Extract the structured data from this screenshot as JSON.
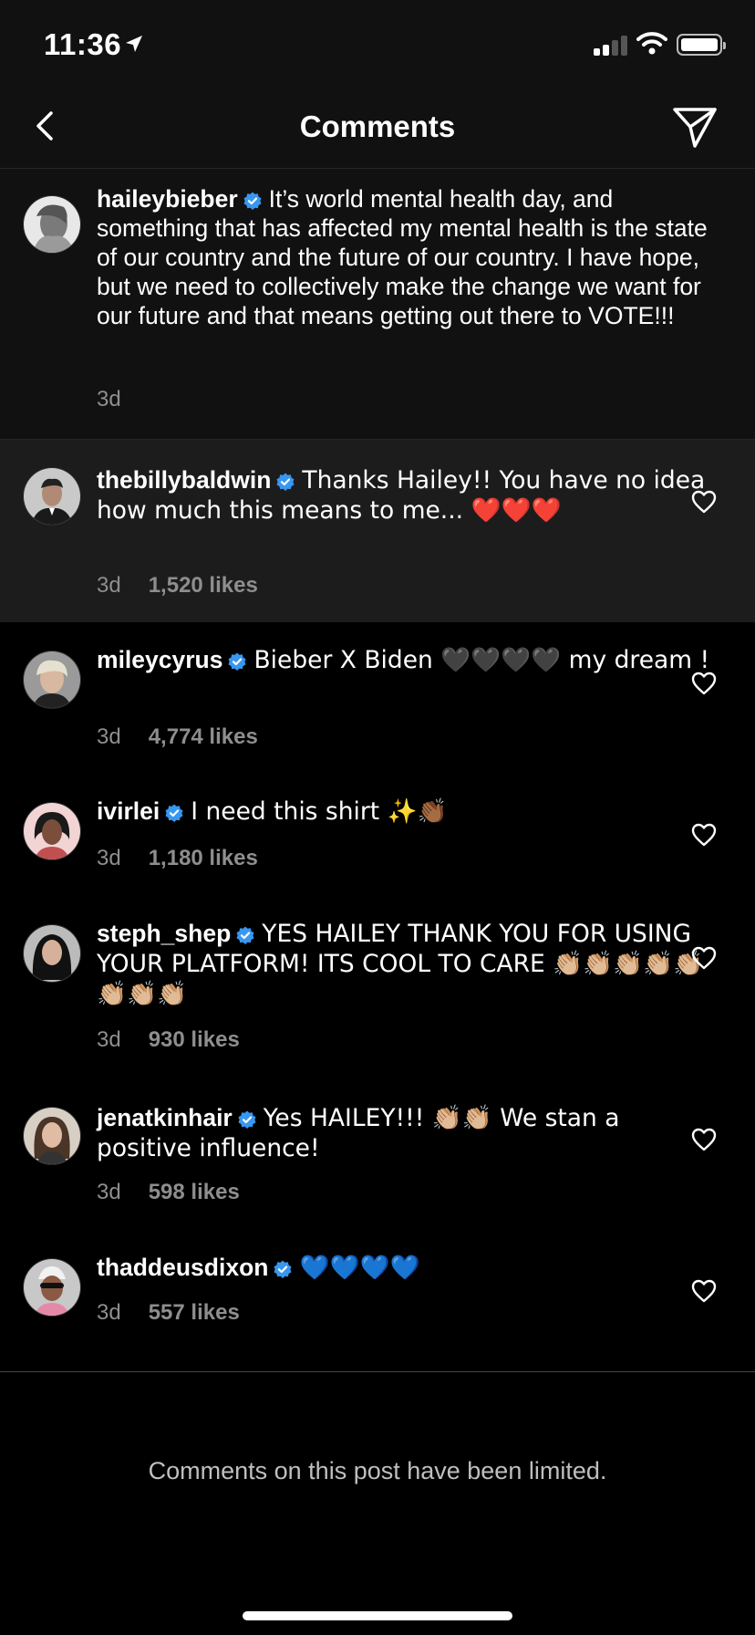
{
  "status_bar": {
    "time": "11:36"
  },
  "header": {
    "title": "Comments"
  },
  "caption": {
    "username": "haileybieber",
    "text": "It’s world mental health day, and something that has affected my mental health is the state of our country and the future of our country. I have hope, but we need to collectively make the change we want for our future and that means getting out there to VOTE!!!",
    "time": "3d"
  },
  "comments": [
    {
      "username": "thebillybaldwin",
      "text": "Thanks Hailey!! You have no idea how much this means to me... ❤️❤️❤️",
      "time": "3d",
      "likes": "1,520 likes"
    },
    {
      "username": "mileycyrus",
      "text": "Bieber X Biden 🖤🖤🖤🖤 my dream !",
      "time": "3d",
      "likes": "4,774 likes"
    },
    {
      "username": "ivirlei",
      "text": "I need this shirt ✨👏🏾",
      "time": "3d",
      "likes": "1,180 likes"
    },
    {
      "username": "steph_shep",
      "text": "YES HAILEY THANK YOU FOR USING YOUR PLATFORM! ITS COOL TO CARE 👏🏼👏🏼👏🏼👏🏼👏🏼👏🏼👏🏼👏🏼",
      "time": "3d",
      "likes": "930 likes"
    },
    {
      "username": "jenatkinhair",
      "text": "Yes HAILEY!!! 👏🏼👏🏼 We stan a positive influence!",
      "time": "3d",
      "likes": "598 likes"
    },
    {
      "username": "thaddeusdixon",
      "text": "💙💙💙💙",
      "time": "3d",
      "likes": "557 likes"
    }
  ],
  "footer": {
    "limited_notice": "Comments on this post have been limited."
  },
  "colors": {
    "background": "#000000",
    "header_background": "#111111",
    "highlight_background": "#1c1c1c",
    "verified_badge": "#3897f0",
    "meta_text": "#8e8e8e"
  },
  "icons": {
    "back": "chevron-left-icon",
    "send": "paper-plane-icon",
    "like": "heart-outline-icon",
    "verified": "verified-badge-icon",
    "location": "location-arrow-icon",
    "signal": "cellular-signal-icon",
    "wifi": "wifi-icon",
    "battery": "battery-icon"
  }
}
